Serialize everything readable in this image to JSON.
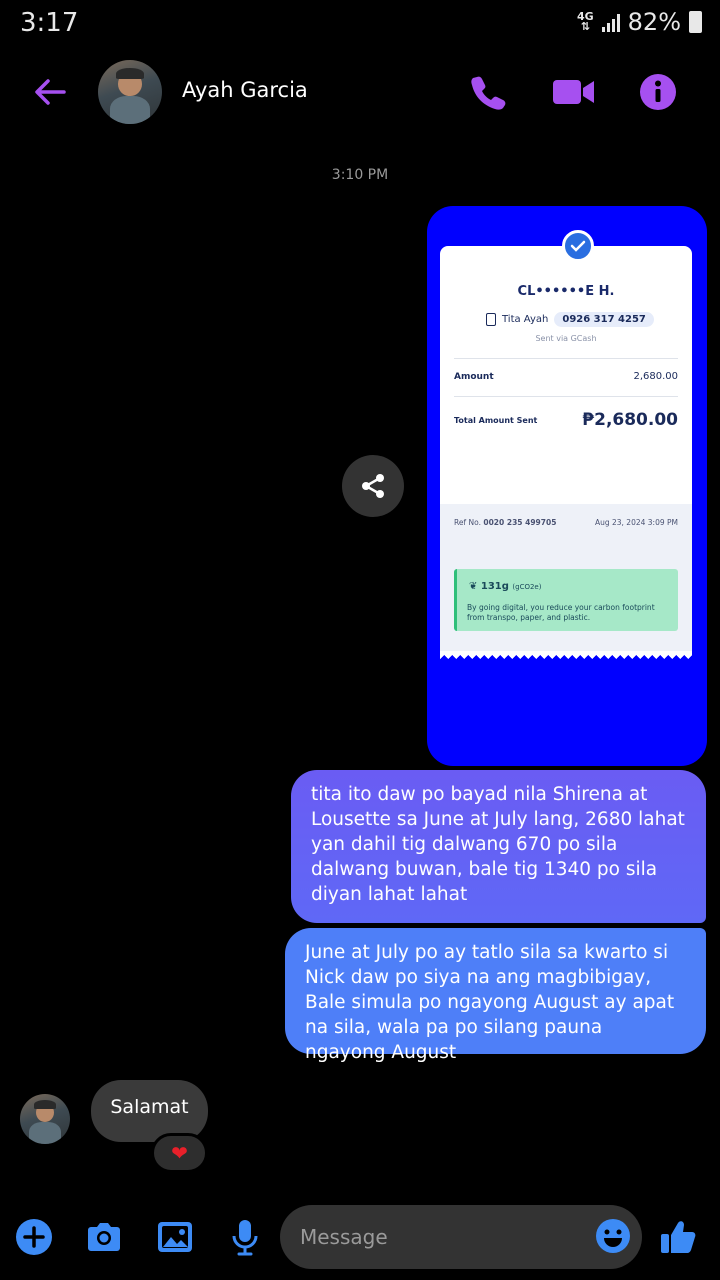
{
  "status_bar": {
    "time": "3:17",
    "network": "4G",
    "battery": "82%"
  },
  "header": {
    "contact_name": "Ayah Garcia",
    "accent": "#a650f0"
  },
  "conversation": {
    "timestamp": "3:10 PM",
    "receipt": {
      "recipient": "CL••••••E H.",
      "sender_name": "Tita Ayah",
      "phone": "0926 317 4257",
      "sent_via": "Sent via GCash",
      "amount_label": "Amount",
      "amount_value": "2,680.00",
      "total_label": "Total Amount Sent",
      "total_value": "₱2,680.00",
      "ref_label": "Ref No.",
      "ref_value": "0020 235 499705",
      "date": "Aug 23, 2024 3:09 PM",
      "carbon_value": "131g",
      "carbon_unit": "(gCO2e)",
      "carbon_text": "By going digital, you reduce your carbon footprint from transpo, paper, and plastic."
    },
    "sent_messages": [
      "tita ito daw po bayad nila Shirena at Lousette sa June at July lang, 2680 lahat yan dahil tig dalwang 670 po sila dalwang buwan, bale tig 1340 po sila diyan lahat lahat",
      "June at July po ay tatlo sila sa kwarto si Nick daw po siya na ang magbibigay, Bale simula po ngayong August ay apat na sila, wala pa po silang pauna ngayong August"
    ],
    "received_message": "Salamat",
    "reaction": "❤"
  },
  "composer": {
    "placeholder": "Message"
  },
  "icons": {
    "back": "back-arrow-icon",
    "call": "phone-icon",
    "video": "video-camera-icon",
    "info": "info-icon",
    "share": "share-icon",
    "add": "plus-icon",
    "camera": "camera-icon",
    "gallery": "image-icon",
    "mic": "microphone-icon",
    "emoji": "emoji-icon",
    "like": "thumbs-up-icon"
  }
}
